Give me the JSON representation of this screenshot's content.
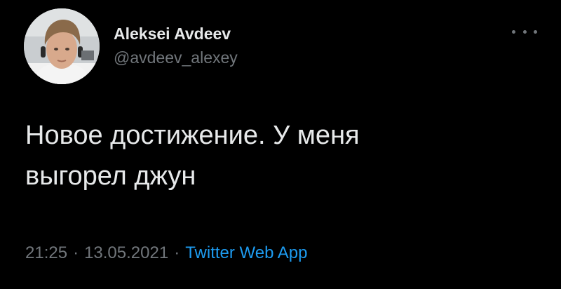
{
  "tweet": {
    "author": {
      "display_name": "Aleksei Avdeev",
      "handle": "@avdeev_alexey"
    },
    "more_icon": "more-horizontal-icon",
    "text": "Новое достижение. У меня\nвыгорел джун",
    "meta": {
      "time": "21:25",
      "separator": "·",
      "date": "13.05.2021",
      "source": "Twitter Web App"
    }
  },
  "colors": {
    "background": "#000000",
    "primary_text": "#e7e9ea",
    "secondary_text": "#71767b",
    "link": "#1d9bf0"
  }
}
